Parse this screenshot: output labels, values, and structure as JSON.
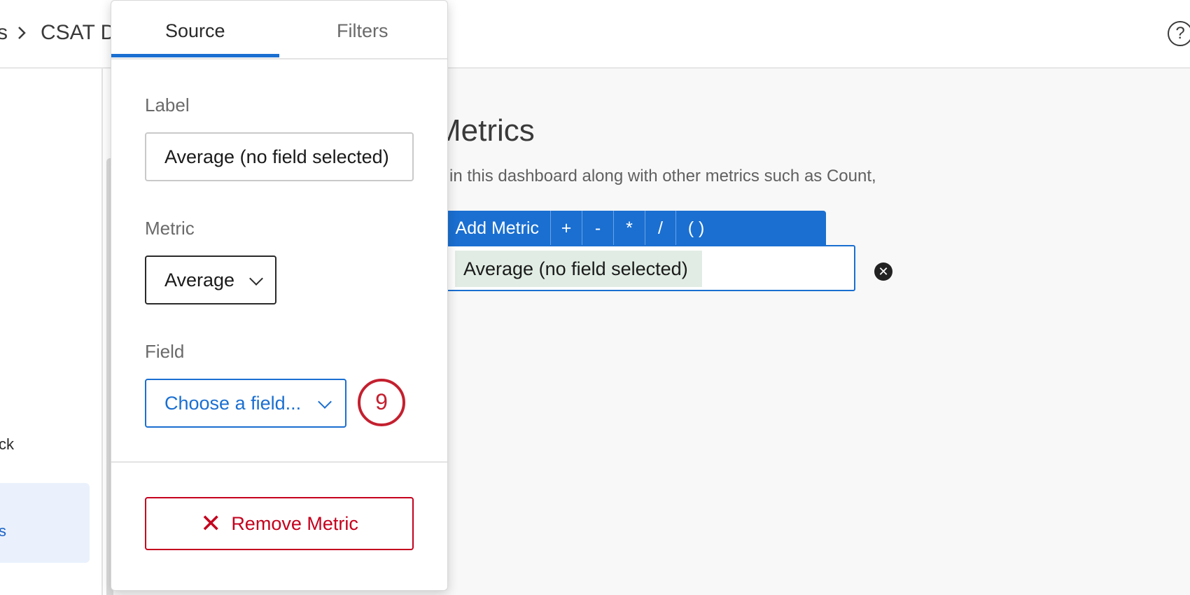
{
  "header": {
    "breadcrumb_partial": "s",
    "breadcrumb_title": "CSAT D",
    "help_glyph": "?"
  },
  "leftnav": {
    "item_partial": "ck",
    "active_item_partial": "s"
  },
  "main": {
    "title": "Metrics",
    "description": "e in this dashboard along with other metrics such as Count,",
    "toolbar": {
      "add_metric": "Add Metric",
      "plus": "+",
      "minus": "-",
      "multiply": "*",
      "divide": "/",
      "parens": "( )"
    },
    "expression_chip": "Average (no field selected)"
  },
  "panel": {
    "tabs": {
      "source": "Source",
      "filters": "Filters",
      "active": "Source"
    },
    "label_heading": "Label",
    "label_value": "Average (no field selected)",
    "metric_heading": "Metric",
    "metric_value": "Average",
    "field_heading": "Field",
    "field_placeholder": "Choose a field...",
    "step_badge": "9",
    "remove_button": "Remove Metric",
    "remove_icon": "✕"
  },
  "colors": {
    "accent": "#1a6fd1",
    "danger": "#c4001d",
    "chip_bg": "#e1ede4",
    "badge": "#c4202f"
  }
}
